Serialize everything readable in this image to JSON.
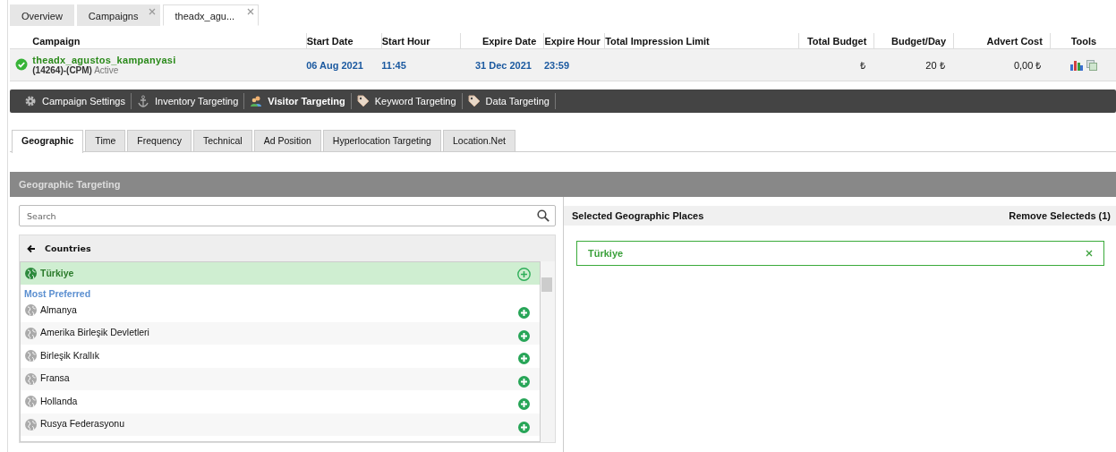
{
  "page_tabs": [
    {
      "label": "Overview",
      "closable": false,
      "selected": false
    },
    {
      "label": "Campaigns",
      "closable": true,
      "selected": false
    },
    {
      "label": "theadx_agu...",
      "closable": true,
      "selected": true
    }
  ],
  "campaign_table": {
    "columns": [
      "Campaign",
      "Start Date",
      "Start Hour",
      "Expire Date",
      "Expire Hour",
      "Total Impression Limit",
      "Total Budget",
      "Budget/Day",
      "Advert Cost",
      "Tools"
    ],
    "rows": [
      {
        "active": true,
        "name": "theadx_agustos_kampanyasi",
        "code": "(14264)-(CPM)",
        "status": "Active",
        "start_date": "06 Aug 2021",
        "start_hour": "11:45",
        "expire_date": "31 Dec 2021",
        "expire_hour": "23:59",
        "total_budget": "₺",
        "budget_day": "20 ₺",
        "advert_cost": "0,00 ₺"
      }
    ]
  },
  "section_nav": [
    {
      "label": "Campaign Settings",
      "selected": false
    },
    {
      "label": "Inventory Targeting",
      "selected": false
    },
    {
      "label": "Visitor Targeting",
      "selected": true
    },
    {
      "label": "Keyword Targeting",
      "selected": false
    },
    {
      "label": "Data Targeting",
      "selected": false
    }
  ],
  "sub_tabs": [
    {
      "label": "Geographic",
      "selected": true
    },
    {
      "label": "Time",
      "selected": false
    },
    {
      "label": "Frequency",
      "selected": false
    },
    {
      "label": "Technical",
      "selected": false
    },
    {
      "label": "Ad Position",
      "selected": false
    },
    {
      "label": "Hyperlocation Targeting",
      "selected": false
    },
    {
      "label": "Location.Net",
      "selected": false
    }
  ],
  "panel": {
    "title": "Geographic Targeting",
    "search": {
      "placeholder": "Search"
    },
    "list_title": "Countries",
    "items": [
      {
        "kind": "place",
        "label": "Türkiye",
        "selected": true
      },
      {
        "kind": "group",
        "label": "Most Preferred"
      },
      {
        "kind": "place",
        "label": "Almanya",
        "selected": false
      },
      {
        "kind": "place",
        "label": "Amerika Birleşik Devletleri",
        "selected": false
      },
      {
        "kind": "place",
        "label": "Birleşik Krallık",
        "selected": false
      },
      {
        "kind": "place",
        "label": "Fransa",
        "selected": false
      },
      {
        "kind": "place",
        "label": "Hollanda",
        "selected": false
      },
      {
        "kind": "place",
        "label": "Rusya Federasyonu",
        "selected": false
      }
    ],
    "selected_title": "Selected Geographic Places",
    "remove_label": "Remove Selecteds (1)",
    "selected_places": [
      "Türkiye"
    ]
  }
}
